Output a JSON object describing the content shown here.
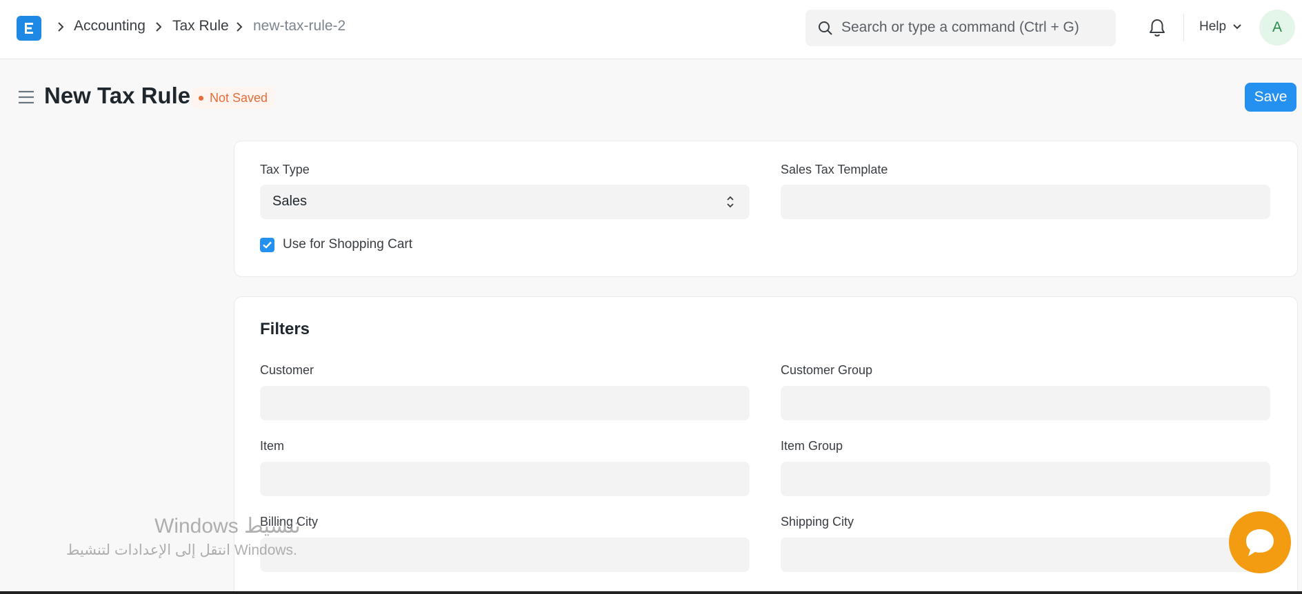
{
  "navbar": {
    "logo_icon": "erpnext-logo",
    "breadcrumbs": [
      "Accounting",
      "Tax Rule",
      "new-tax-rule-2"
    ],
    "search_placeholder": "Search or type a command (Ctrl + G)",
    "help_label": "Help",
    "avatar_initial": "A"
  },
  "page": {
    "title": "New Tax Rule",
    "status": "Not Saved",
    "save_label": "Save"
  },
  "form": {
    "tax_type_label": "Tax Type",
    "tax_type_value": "Sales",
    "sales_tax_template_label": "Sales Tax Template",
    "sales_tax_template_value": "",
    "shopping_cart_label": "Use for Shopping Cart",
    "shopping_cart_checked": true
  },
  "filters": {
    "title": "Filters",
    "customer_label": "Customer",
    "customer_group_label": "Customer Group",
    "item_label": "Item",
    "item_group_label": "Item Group",
    "billing_city_label": "Billing City",
    "shipping_city_label": "Shipping City"
  },
  "watermark": {
    "line1": "تنشيط Windows",
    "line2": "انتقل إلى الإعدادات لتنشيط Windows."
  },
  "colors": {
    "primary": "#2490ef",
    "not_saved": "#e86c3a",
    "chat": "#f39c12"
  }
}
